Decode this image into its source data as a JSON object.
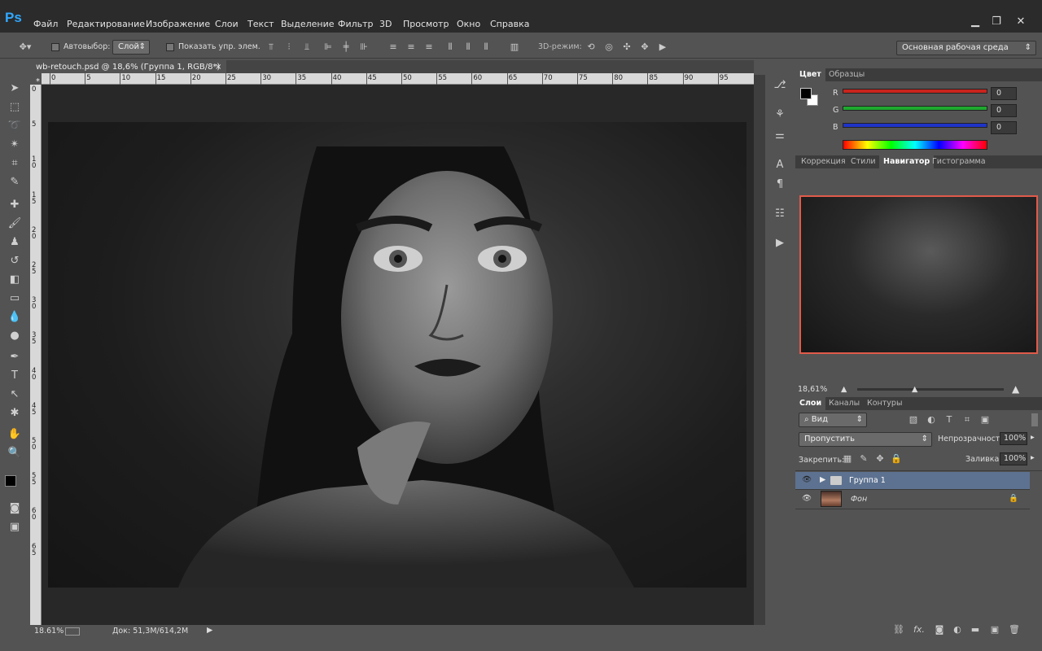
{
  "app": {
    "logo": "Ps",
    "menu": [
      "Файл",
      "Редактирование",
      "Изображение",
      "Слои",
      "Текст",
      "Выделение",
      "Фильтр",
      "3D",
      "Просмотр",
      "Окно",
      "Справка"
    ],
    "window_controls": {
      "minimize": "▁",
      "restore": "❐",
      "close": "✕"
    }
  },
  "options": {
    "autoselect_label": "Автовыбор:",
    "autoselect_value": "Слой",
    "show_transform_label": "Показать упр. элем.",
    "mode3d_label": "3D-режим:",
    "workspace": "Основная рабочая среда"
  },
  "document": {
    "tab_title": "wb-retouch.psd @ 18,6% (Группа 1, RGB/8*) *",
    "close": "×",
    "ruler_h": [
      "0",
      "5",
      "10",
      "15",
      "20",
      "25",
      "30",
      "35",
      "40",
      "45",
      "50",
      "55",
      "60",
      "65",
      "70",
      "75",
      "80",
      "85",
      "90",
      "95"
    ],
    "ruler_v": [
      "0",
      "5",
      "1 0",
      "1 5",
      "2 0",
      "2 5",
      "3 0",
      "3 5",
      "4 0",
      "4 5",
      "5 0",
      "5 5",
      "6 0",
      "6 5"
    ],
    "status_zoom": "18.61%",
    "status_doc": "Док: 51,3M/614,2M"
  },
  "color_panel": {
    "tabs": [
      "Цвет",
      "Образцы"
    ],
    "channels": [
      {
        "label": "R",
        "value": "0",
        "color": "#c8241c"
      },
      {
        "label": "G",
        "value": "0",
        "color": "#1ea82e"
      },
      {
        "label": "B",
        "value": "0",
        "color": "#1e34c8"
      }
    ]
  },
  "navigator": {
    "tabs": [
      "Коррекция",
      "Стили",
      "Навигатор",
      "Гистограмма"
    ],
    "zoom": "18,61%",
    "frame_color": "#e05a4a"
  },
  "layers": {
    "tabs": [
      "Слои",
      "Каналы",
      "Контуры"
    ],
    "filter": "Вид",
    "blend": "Пропустить",
    "opacity_label": "Непрозрачность:",
    "opacity": "100%",
    "lock_label": "Закрепить:",
    "fill_label": "Заливка:",
    "fill": "100%",
    "items": [
      {
        "name": "Группа 1",
        "type": "group",
        "selected": true
      },
      {
        "name": "Фон",
        "type": "pixel",
        "selected": false,
        "locked": true
      }
    ],
    "fx": "fx."
  }
}
